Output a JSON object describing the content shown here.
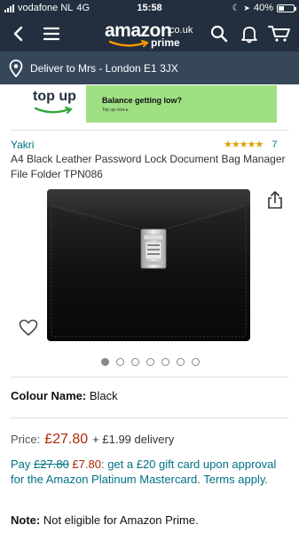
{
  "status_bar": {
    "carrier": "vodafone NL",
    "network": "4G",
    "time": "15:58",
    "battery": "40%",
    "battery_level": 0.4
  },
  "header": {
    "logo_word": "amazon",
    "logo_tld": ".co.uk",
    "logo_prime": "prime",
    "icons": [
      "back-icon",
      "menu-icon",
      "search-icon",
      "notification-bell-icon",
      "cart-icon"
    ]
  },
  "delivery": {
    "label": "Deliver to Mrs - London E1 3JX",
    "icon": "location-pin-icon"
  },
  "banner": {
    "brand": "top up",
    "title": "Balance getting low?",
    "subtitle": "Top up now ▸"
  },
  "product": {
    "brand": "Yakri",
    "rating_stars": 4.5,
    "stars_display": "★★★★★",
    "rating_count": "7",
    "title": "A4 Black Leather Password Lock Document Bag Manager File Folder TPN086",
    "image_count": 7,
    "active_image": 0,
    "colour_label": "Colour Name:",
    "colour_value": "Black"
  },
  "pricing": {
    "label": "Price:",
    "price": "£27.80",
    "delivery": "+ £1.99 delivery"
  },
  "promo": {
    "prefix": "Pay",
    "old_price": "£27.80",
    "new_price": "£7.80",
    "text": ": get a £20 gift card upon approval for the Amazon Platinum Mastercard. Terms apply."
  },
  "note": {
    "label": "Note:",
    "text": "Not eligible for Amazon Prime."
  },
  "colors": {
    "nav_dark": "#232f3e",
    "nav_secondary": "#37475a",
    "link": "#007185",
    "price": "#b12704",
    "star": "#e0a000",
    "banner_green": "#a0e085"
  }
}
